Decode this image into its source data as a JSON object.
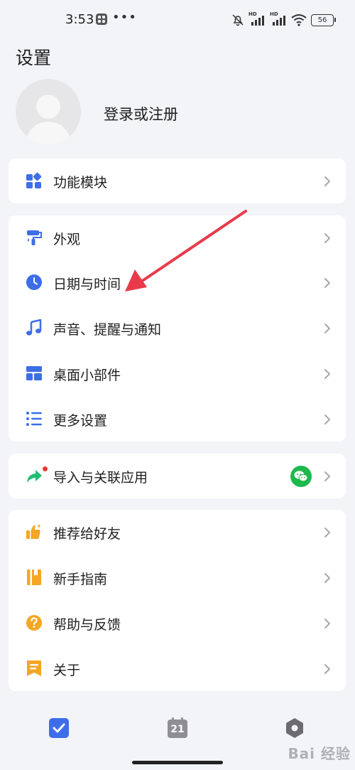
{
  "status_bar": {
    "time": "3:53",
    "battery": "56",
    "signal_label": "HD"
  },
  "header": {
    "title": "设置"
  },
  "profile": {
    "login_text": "登录或注册"
  },
  "groups": {
    "g1": [
      {
        "label": "功能模块",
        "icon": "grid-icon"
      }
    ],
    "g2": [
      {
        "label": "外观",
        "icon": "paint-roller-icon"
      },
      {
        "label": "日期与时间",
        "icon": "clock-icon"
      },
      {
        "label": "声音、提醒与通知",
        "icon": "music-note-icon"
      },
      {
        "label": "桌面小部件",
        "icon": "widget-layout-icon"
      },
      {
        "label": "更多设置",
        "icon": "list-icon"
      }
    ],
    "g3": [
      {
        "label": "导入与关联应用",
        "icon": "share-arrow-icon",
        "badge_icon": "wechat-icon"
      }
    ],
    "g4": [
      {
        "label": "推荐给好友",
        "icon": "thumbs-up-icon"
      },
      {
        "label": "新手指南",
        "icon": "book-icon"
      },
      {
        "label": "帮助与反馈",
        "icon": "help-circle-icon"
      },
      {
        "label": "关于",
        "icon": "document-icon"
      }
    ]
  },
  "tab_bar": {
    "calendar_day": "21"
  },
  "watermark": "Bai 经验",
  "colors": {
    "accent": "#3d6ee8",
    "green": "#1eb84c",
    "orange": "#f5a623",
    "arrow": "#e83a4a"
  }
}
